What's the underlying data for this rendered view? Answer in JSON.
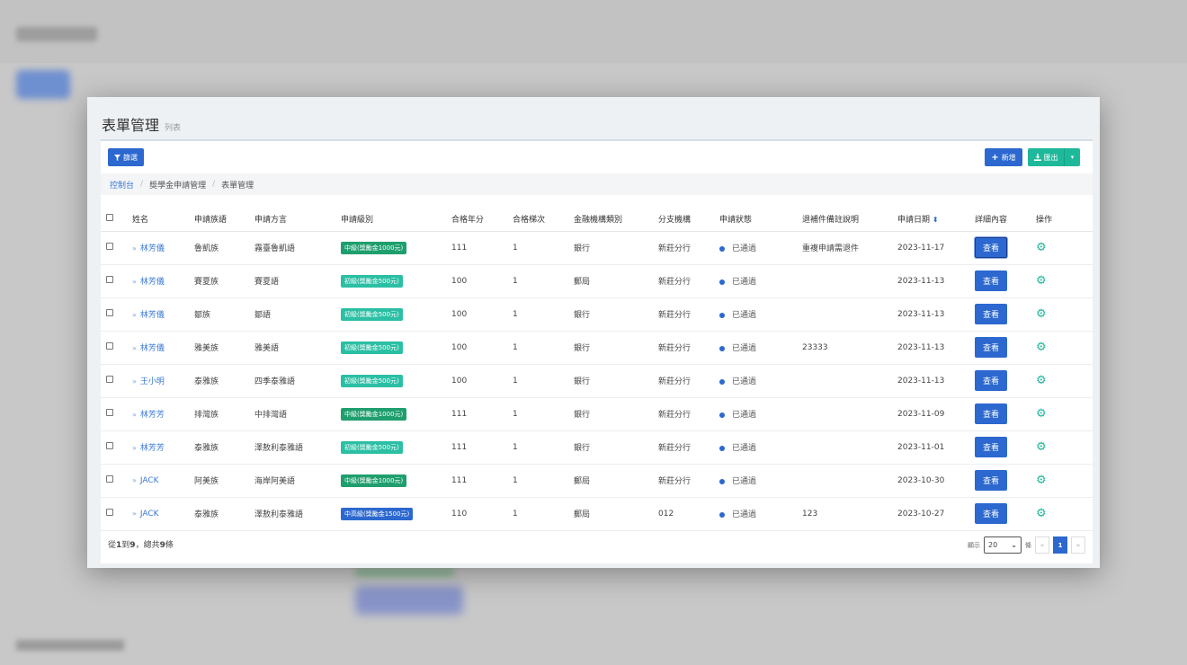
{
  "modal": {
    "title": "表單管理",
    "subtitle": "列表"
  },
  "toolbar": {
    "filter_label": "篩選",
    "add_label": "新增",
    "export_label": "匯出"
  },
  "breadcrumb": [
    "控制台",
    "獎學金申請管理",
    "表單管理"
  ],
  "table": {
    "headers": [
      "姓名",
      "申請族語",
      "申請方言",
      "申請級別",
      "合格年分",
      "合格梯次",
      "金融機構類別",
      "分支機構",
      "申請狀態",
      "退補件備註說明",
      "申請日期",
      "詳細內容",
      "操作"
    ],
    "view_label": "查看",
    "rows": [
      {
        "name": "林芳儀",
        "lang": "魯凱族",
        "dialect": "霧臺魯凱語",
        "level": "中級(獎勵金1000元)",
        "level_color": "#1f9e6e",
        "year": "111",
        "batch": "1",
        "bank": "銀行",
        "branch": "新莊分行",
        "status": "已通過",
        "note": "重複申請需退件",
        "date": "2023-11-17"
      },
      {
        "name": "林芳儀",
        "lang": "賽夏族",
        "dialect": "賽夏語",
        "level": "初級(獎勵金500元)",
        "level_color": "#2bbfa4",
        "year": "100",
        "batch": "1",
        "bank": "郵局",
        "branch": "新莊分行",
        "status": "已通過",
        "note": "",
        "date": "2023-11-13"
      },
      {
        "name": "林芳儀",
        "lang": "鄒族",
        "dialect": "鄒語",
        "level": "初級(獎勵金500元)",
        "level_color": "#2bbfa4",
        "year": "100",
        "batch": "1",
        "bank": "銀行",
        "branch": "新莊分行",
        "status": "已通過",
        "note": "",
        "date": "2023-11-13"
      },
      {
        "name": "林芳儀",
        "lang": "雅美族",
        "dialect": "雅美語",
        "level": "初級(獎勵金500元)",
        "level_color": "#2bbfa4",
        "year": "100",
        "batch": "1",
        "bank": "銀行",
        "branch": "新莊分行",
        "status": "已通過",
        "note": "23333",
        "date": "2023-11-13"
      },
      {
        "name": "王小明",
        "lang": "泰雅族",
        "dialect": "四季泰雅語",
        "level": "初級(獎勵金500元)",
        "level_color": "#2bbfa4",
        "year": "100",
        "batch": "1",
        "bank": "銀行",
        "branch": "新莊分行",
        "status": "已通過",
        "note": "",
        "date": "2023-11-13"
      },
      {
        "name": "林芳芳",
        "lang": "排灣族",
        "dialect": "中排灣語",
        "level": "中級(獎勵金1000元)",
        "level_color": "#1f9e6e",
        "year": "111",
        "batch": "1",
        "bank": "銀行",
        "branch": "新莊分行",
        "status": "已通過",
        "note": "",
        "date": "2023-11-09"
      },
      {
        "name": "林芳芳",
        "lang": "泰雅族",
        "dialect": "澤敖利泰雅語",
        "level": "初級(獎勵金500元)",
        "level_color": "#2bbfa4",
        "year": "111",
        "batch": "1",
        "bank": "銀行",
        "branch": "新莊分行",
        "status": "已通過",
        "note": "",
        "date": "2023-11-01"
      },
      {
        "name": "JACK",
        "lang": "阿美族",
        "dialect": "海岸阿美語",
        "level": "中級(獎勵金1000元)",
        "level_color": "#1f9e6e",
        "year": "111",
        "batch": "1",
        "bank": "郵局",
        "branch": "新莊分行",
        "status": "已通過",
        "note": "",
        "date": "2023-10-30"
      },
      {
        "name": "JACK",
        "lang": "泰雅族",
        "dialect": "澤敖利泰雅語",
        "level": "中高級(獎勵金1500元)",
        "level_color": "#2c68cf",
        "year": "110",
        "batch": "1",
        "bank": "郵局",
        "branch": "012",
        "status": "已通過",
        "note": "123",
        "date": "2023-10-27"
      }
    ]
  },
  "footer": {
    "info_prefix": "從",
    "from": "1",
    "to_word": "到",
    "to": "9",
    "total_word": "，總共",
    "total": "9",
    "unit": "條",
    "show_label": "顯示",
    "page_size": "20",
    "page_size_suffix": "條",
    "prev": "«",
    "current_page": "1",
    "next": "»"
  },
  "colors": {
    "primary": "#2c68cf",
    "success": "#1eb89a"
  }
}
